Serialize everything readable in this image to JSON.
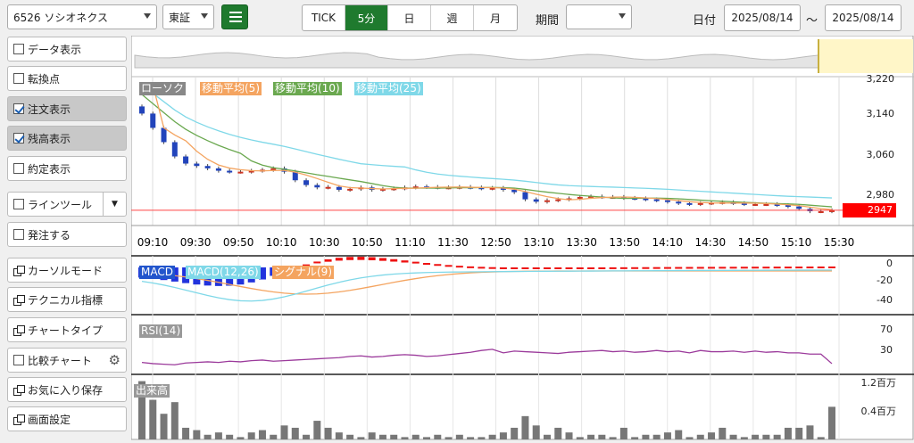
{
  "toolbar": {
    "symbol": "6526 ソシオネクス",
    "market": "東証",
    "tabs": [
      "TICK",
      "5分",
      "日",
      "週",
      "月"
    ],
    "active_tab": "5分",
    "period_label": "期間",
    "period_value": "",
    "date_label": "日付",
    "date_from": "2025/08/14",
    "date_sep": "～",
    "date_to": "2025/08/14"
  },
  "sidebar": [
    {
      "label": "データ表示",
      "type": "checkbox",
      "checked": false
    },
    {
      "label": "転換点",
      "type": "checkbox",
      "checked": false
    },
    {
      "label": "注文表示",
      "type": "checkbox",
      "checked": true
    },
    {
      "label": "残高表示",
      "type": "checkbox",
      "checked": true
    },
    {
      "label": "約定表示",
      "type": "checkbox",
      "checked": false
    },
    {
      "label": "ラインツール",
      "type": "checkbox",
      "checked": false
    },
    {
      "label": "発注する",
      "type": "checkbox",
      "checked": false
    },
    {
      "label": "カーソルモード",
      "type": "icon"
    },
    {
      "label": "テクニカル指標",
      "type": "icon"
    },
    {
      "label": "チャートタイプ",
      "type": "icon"
    },
    {
      "label": "比較チャート",
      "type": "checkbox",
      "checked": false
    },
    {
      "label": "お気に入り保存",
      "type": "icon"
    },
    {
      "label": "画面設定",
      "type": "icon"
    }
  ],
  "price_legend": [
    {
      "name": "ローソク",
      "color": "#7f7f7f"
    },
    {
      "name": "移動平均(5)",
      "color": "#f4a460"
    },
    {
      "name": "移動平均(10)",
      "color": "#6aa84f"
    },
    {
      "name": "移動平均(25)",
      "color": "#7fd8e8"
    }
  ],
  "price_axis": [
    "3,220",
    "3,140",
    "3,060",
    "2,980"
  ],
  "current_price": "2947",
  "time_labels": [
    "09:10",
    "09:30",
    "09:50",
    "10:10",
    "10:30",
    "10:50",
    "11:10",
    "11:30",
    "12:50",
    "13:10",
    "13:30",
    "13:50",
    "14:10",
    "14:30",
    "14:50",
    "15:10",
    "15:30"
  ],
  "macd_legend": [
    {
      "name": "MACD",
      "color": "#2255cc"
    },
    {
      "name": "MACD(12,26)",
      "color": "#7fd8e8"
    },
    {
      "name": "シグナル(9)",
      "color": "#f4a460"
    }
  ],
  "macd_axis": [
    "0",
    "-20",
    "-40"
  ],
  "rsi_legend": "RSI(14)",
  "rsi_axis": [
    "70",
    "30"
  ],
  "volume_legend": "出来高",
  "volume_axis": [
    "1.2百万",
    "0.4百万"
  ],
  "colors": {
    "accent": "#1f7a2e",
    "up": "#cc3322",
    "down": "#2244bb",
    "price_line": "#ff0000"
  },
  "chart_data": [
    {
      "type": "candlestick",
      "title": "ローソク",
      "x_label_times": [
        "09:10",
        "09:30",
        "09:50",
        "10:10",
        "10:30",
        "10:50",
        "11:10",
        "11:30",
        "12:50",
        "13:10",
        "13:30",
        "13:50",
        "14:10",
        "14:30",
        "14:50",
        "15:10",
        "15:30"
      ],
      "close": [
        3150,
        3120,
        3090,
        3060,
        3045,
        3040,
        3035,
        3030,
        3028,
        3028,
        3030,
        3032,
        3035,
        3028,
        3010,
        3000,
        2995,
        2996,
        2990,
        2992,
        2995,
        2990,
        2992,
        2993,
        2995,
        2997,
        2996,
        2995,
        2995,
        2996,
        2995,
        2993,
        2994,
        2990,
        2985,
        2970,
        2965,
        2968,
        2970,
        2972,
        2975,
        2976,
        2975,
        2975,
        2973,
        2972,
        2970,
        2968,
        2965,
        2962,
        2960,
        2962,
        2963,
        2964,
        2962,
        2960,
        2960,
        2960,
        2958,
        2955,
        2950,
        2945,
        2945,
        2947
      ],
      "ylim": [
        2930,
        3220
      ]
    },
    {
      "type": "line",
      "title": "移動平均",
      "series": [
        {
          "name": "移動平均(5)"
        },
        {
          "name": "移動平均(10)"
        },
        {
          "name": "移動平均(25)"
        }
      ]
    },
    {
      "type": "line",
      "title": "MACD",
      "series": [
        {
          "name": "MACD(12,26)"
        },
        {
          "name": "シグナル(9)"
        }
      ],
      "ylim": [
        -45,
        5
      ]
    },
    {
      "type": "line",
      "title": "RSI(14)",
      "values": [
        20,
        18,
        17,
        16,
        19,
        20,
        21,
        20,
        22,
        21,
        23,
        24,
        22,
        23,
        24,
        25,
        26,
        27,
        28,
        30,
        31,
        29,
        30,
        32,
        33,
        32,
        30,
        31,
        33,
        35,
        37,
        40,
        42,
        36,
        39,
        38,
        37,
        36,
        35,
        37,
        38,
        39,
        40,
        38,
        39,
        37,
        38,
        40,
        38,
        39,
        36,
        40,
        38,
        38,
        39,
        37,
        39,
        37,
        38,
        36,
        36,
        34,
        34,
        18
      ],
      "ylim": [
        0,
        100
      ]
    },
    {
      "type": "bar",
      "title": "出来高",
      "values": [
        1.25,
        0.85,
        0.55,
        0.8,
        0.25,
        0.2,
        0.1,
        0.15,
        0.1,
        0.05,
        0.15,
        0.2,
        0.1,
        0.3,
        0.25,
        0.1,
        0.4,
        0.25,
        0.15,
        0.1,
        0.05,
        0.15,
        0.1,
        0.1,
        0.05,
        0.1,
        0.05,
        0.1,
        0.05,
        0.1,
        0.05,
        0.05,
        0.1,
        0.15,
        0.25,
        0.5,
        0.3,
        0.1,
        0.25,
        0.15,
        0.05,
        0.1,
        0.1,
        0.05,
        0.25,
        0.05,
        0.1,
        0.1,
        0.15,
        0.2,
        0.05,
        0.1,
        0.15,
        0.25,
        0.1,
        0.05,
        0.1,
        0.1,
        0.1,
        0.25,
        0.25,
        0.3,
        0.05,
        0.7
      ],
      "ylim": [
        0,
        1.3
      ]
    }
  ]
}
